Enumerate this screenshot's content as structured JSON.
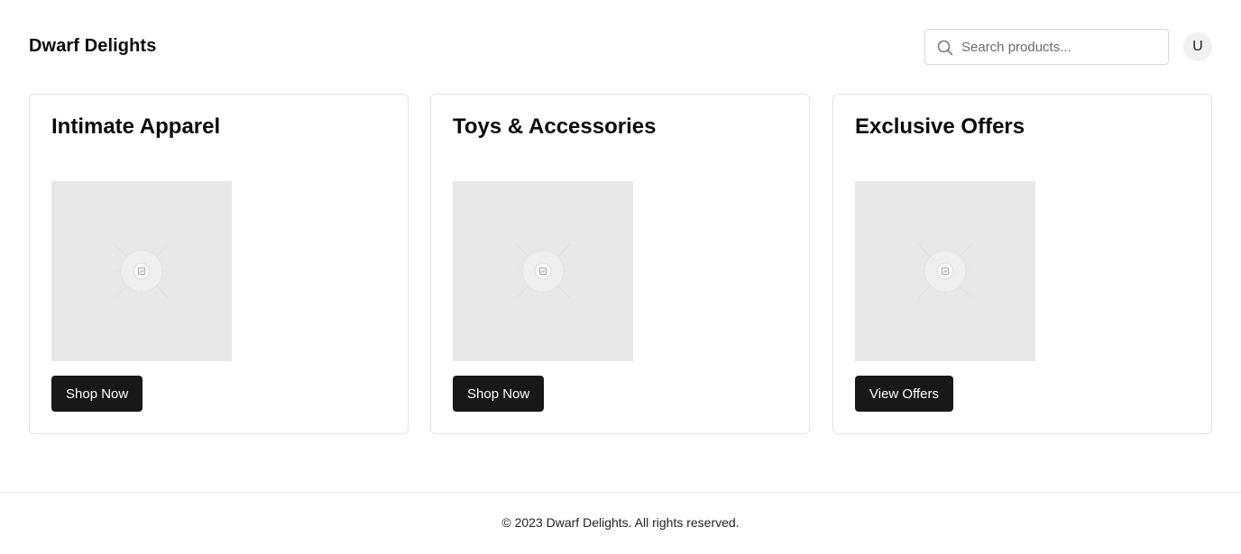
{
  "header": {
    "brand": "Dwarf Delights",
    "search": {
      "placeholder": "Search products...",
      "value": "",
      "icon": "search-icon"
    },
    "avatar": {
      "initial": "U"
    }
  },
  "cards": [
    {
      "title": "Intimate Apparel",
      "image_icon": "image-placeholder-icon",
      "button_label": "Shop Now"
    },
    {
      "title": "Toys & Accessories",
      "image_icon": "image-placeholder-icon",
      "button_label": "Shop Now"
    },
    {
      "title": "Exclusive Offers",
      "image_icon": "image-placeholder-icon",
      "button_label": "View Offers"
    }
  ],
  "footer": {
    "text": "© 2023 Dwarf Delights. All rights reserved."
  },
  "colors": {
    "button_bg": "#18181b",
    "button_text": "#ffffff",
    "image_placeholder": "#e8e8e8",
    "border": "#e4e4e4"
  }
}
